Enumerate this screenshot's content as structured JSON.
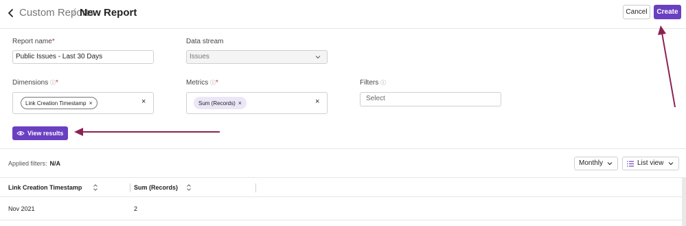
{
  "header": {
    "back_icon": "chevron-left-icon",
    "breadcrumb_parent": "Custom Reports",
    "breadcrumb_separator": "/",
    "title": "New Report",
    "cancel_label": "Cancel",
    "create_label": "Create"
  },
  "form": {
    "report_name": {
      "label": "Report name",
      "required_mark": "*",
      "value": "Public Issues - Last 30 Days"
    },
    "data_stream": {
      "label": "Data stream",
      "value": "Issues"
    },
    "dimensions": {
      "label": "Dimensions",
      "info_icon": "ⓘ",
      "required_mark": "*",
      "chips": [
        "Link Creation Timestamp"
      ],
      "chip_remove": "×",
      "clear": "×"
    },
    "metrics": {
      "label": "Metrics",
      "info_icon": "ⓘ",
      "required_mark": "*",
      "chips": [
        "Sum (Records)"
      ],
      "chip_remove": "×",
      "clear": "×"
    },
    "filters": {
      "label": "Filters",
      "info_icon": "ⓘ",
      "placeholder": "Select"
    },
    "view_results_label": "View results"
  },
  "results": {
    "applied_filters_label": "Applied filters:",
    "applied_filters_value": "N/A",
    "granularity": "Monthly",
    "view_mode": "List view",
    "columns": [
      "Link Creation Timestamp",
      "Sum (Records)"
    ],
    "rows": [
      [
        "Nov 2021",
        "2"
      ]
    ]
  },
  "colors": {
    "accent": "#6a3fc1",
    "annotation_arrow": "#8b2252"
  }
}
